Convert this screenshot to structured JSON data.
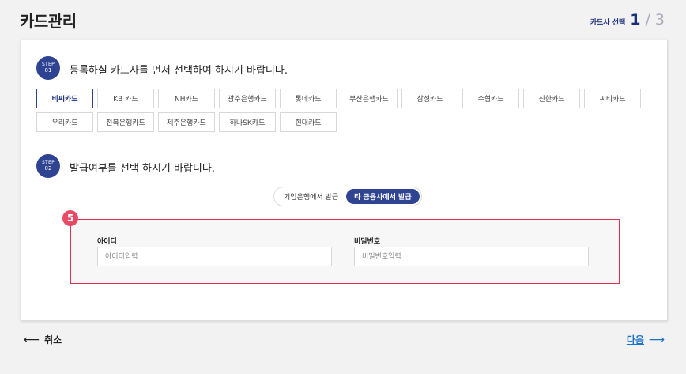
{
  "page": {
    "title": "카드관리",
    "step_label": "카드사 선택",
    "step_current": "1",
    "step_separator": "/",
    "step_total": "3"
  },
  "step1": {
    "badge_top": "STEP",
    "badge_num": "01",
    "heading": "등록하실 카드사를 먼저 선택하여 하시기 바랍니다.",
    "cards": [
      {
        "label": "비씨카드",
        "selected": true
      },
      {
        "label": "KB 카드",
        "selected": false
      },
      {
        "label": "NH카드",
        "selected": false
      },
      {
        "label": "광주은행카드",
        "selected": false
      },
      {
        "label": "롯데카드",
        "selected": false
      },
      {
        "label": "부산은행카드",
        "selected": false
      },
      {
        "label": "삼성카드",
        "selected": false
      },
      {
        "label": "수협카드",
        "selected": false
      },
      {
        "label": "신한카드",
        "selected": false
      },
      {
        "label": "씨티카드",
        "selected": false
      },
      {
        "label": "우리카드",
        "selected": false
      },
      {
        "label": "전북은행카드",
        "selected": false
      },
      {
        "label": "제주은행카드",
        "selected": false
      },
      {
        "label": "하나SK카드",
        "selected": false
      },
      {
        "label": "현대카드",
        "selected": false
      }
    ]
  },
  "step2": {
    "badge_top": "STEP",
    "badge_num": "02",
    "heading": "발급여부를 선택 하시기 바랍니다.",
    "options": [
      {
        "label": "기업은행에서 발급",
        "active": false
      },
      {
        "label": "타 금융사에서 발급",
        "active": true
      }
    ]
  },
  "annotation": {
    "number": "5",
    "color": "#d9334f"
  },
  "form": {
    "id_label": "아이디",
    "id_placeholder": "아이디입력",
    "password_label": "비밀번호",
    "password_placeholder": "비밀번호입력"
  },
  "footer": {
    "cancel_arrow": "⟵",
    "cancel_label": "취소",
    "next_label": "다음",
    "next_arrow": "⟶"
  },
  "colors": {
    "primary": "#2f4393",
    "link": "#1a73c9",
    "annotation": "#e64a64"
  }
}
